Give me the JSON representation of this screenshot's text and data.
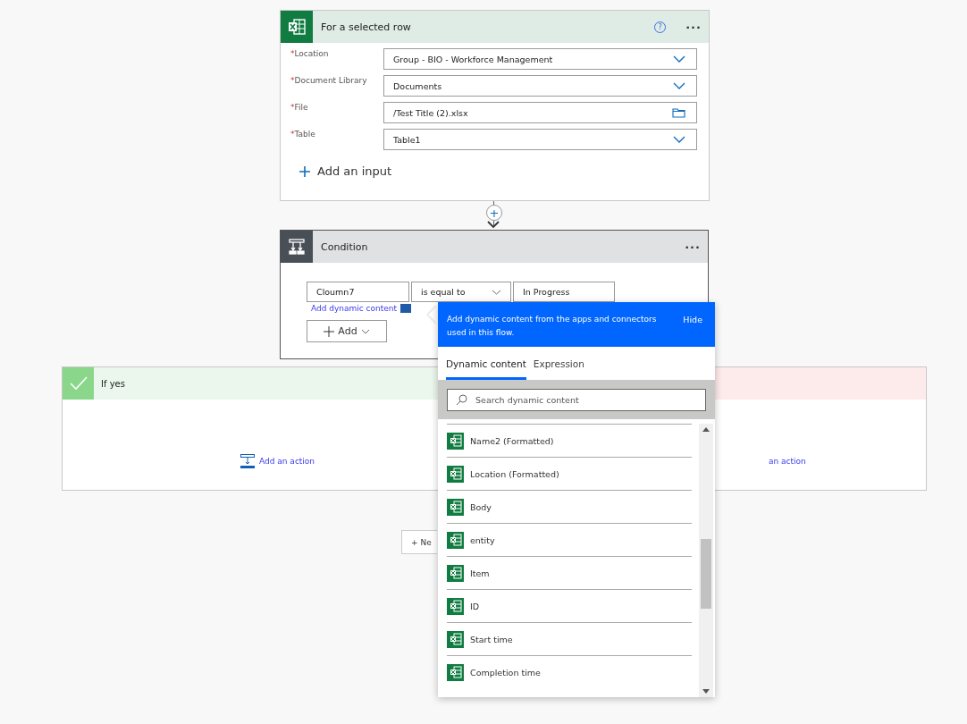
{
  "trigger": {
    "title": "For a selected row",
    "help": "?",
    "more": "···",
    "fields": [
      {
        "label": "Location",
        "required_mark": "*",
        "value": "Group - BIO - Workforce Management",
        "kind": "dropdown"
      },
      {
        "label": "Document Library",
        "required_mark": "*",
        "value": "Documents",
        "kind": "dropdown"
      },
      {
        "label": "File",
        "required_mark": "*",
        "value": "/Test Title  (2).xlsx",
        "kind": "file"
      },
      {
        "label": "Table",
        "required_mark": "*",
        "value": "Table1",
        "kind": "dropdown"
      }
    ],
    "add_input": "Add an input"
  },
  "connector": {
    "plus": "+"
  },
  "condition": {
    "title": "Condition",
    "more": "···",
    "left": "Cloumn7",
    "operator": "is equal to",
    "right": "In Progress",
    "dynamic_link": "Add dynamic content",
    "add_button": "Add"
  },
  "branches": [
    {
      "kind": "yes",
      "title": "If yes",
      "action": "Add an action"
    },
    {
      "kind": "no",
      "action": "an action"
    }
  ],
  "new_step": "+ Ne",
  "dynamic_panel": {
    "message": "Add dynamic content from the apps and connectors used in this flow.",
    "hide": "Hide",
    "tabs": [
      {
        "label": "Dynamic content",
        "selected": true
      },
      {
        "label": "Expression",
        "selected": false
      }
    ],
    "search": {
      "placeholder": "Search dynamic content"
    },
    "items": [
      "Name2 (Formatted)",
      "Location (Formatted)",
      "Body",
      "entity",
      "Item",
      "ID",
      "Start time",
      "Completion time"
    ]
  }
}
